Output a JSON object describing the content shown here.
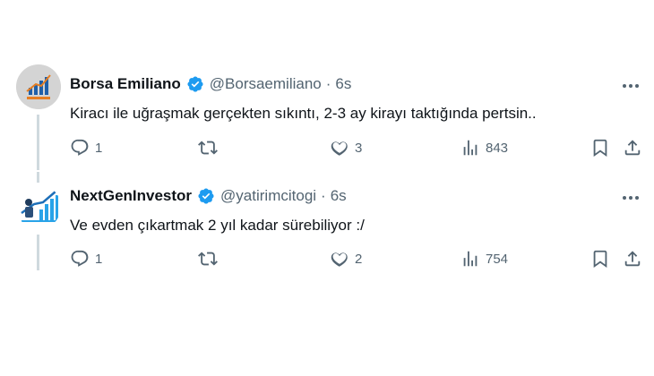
{
  "tweets": [
    {
      "name": "Borsa Emiliano",
      "handle": "@Borsaemiliano",
      "separator": "·",
      "time": "6s",
      "text": "Kiracı ile uğraşmak gerçekten sıkıntı, 2-3 ay kirayı taktığında pertsin..",
      "replies": "1",
      "retweets": "",
      "likes": "3",
      "views": "843"
    },
    {
      "name": "NextGenInvestor",
      "handle": "@yatirimcitogi",
      "separator": "·",
      "time": "6s",
      "text": "Ve evden çıkartmak 2 yıl kadar sürebiliyor :/",
      "replies": "1",
      "retweets": "",
      "likes": "2",
      "views": "754"
    }
  ],
  "colors": {
    "verified": "#1d9bf0",
    "muted": "#536471",
    "text": "#0f1419",
    "thread": "#cfd9de"
  },
  "icons": [
    "verified-badge-icon",
    "more-icon",
    "reply-icon",
    "retweet-icon",
    "like-icon",
    "views-icon",
    "bookmark-icon",
    "share-icon"
  ]
}
